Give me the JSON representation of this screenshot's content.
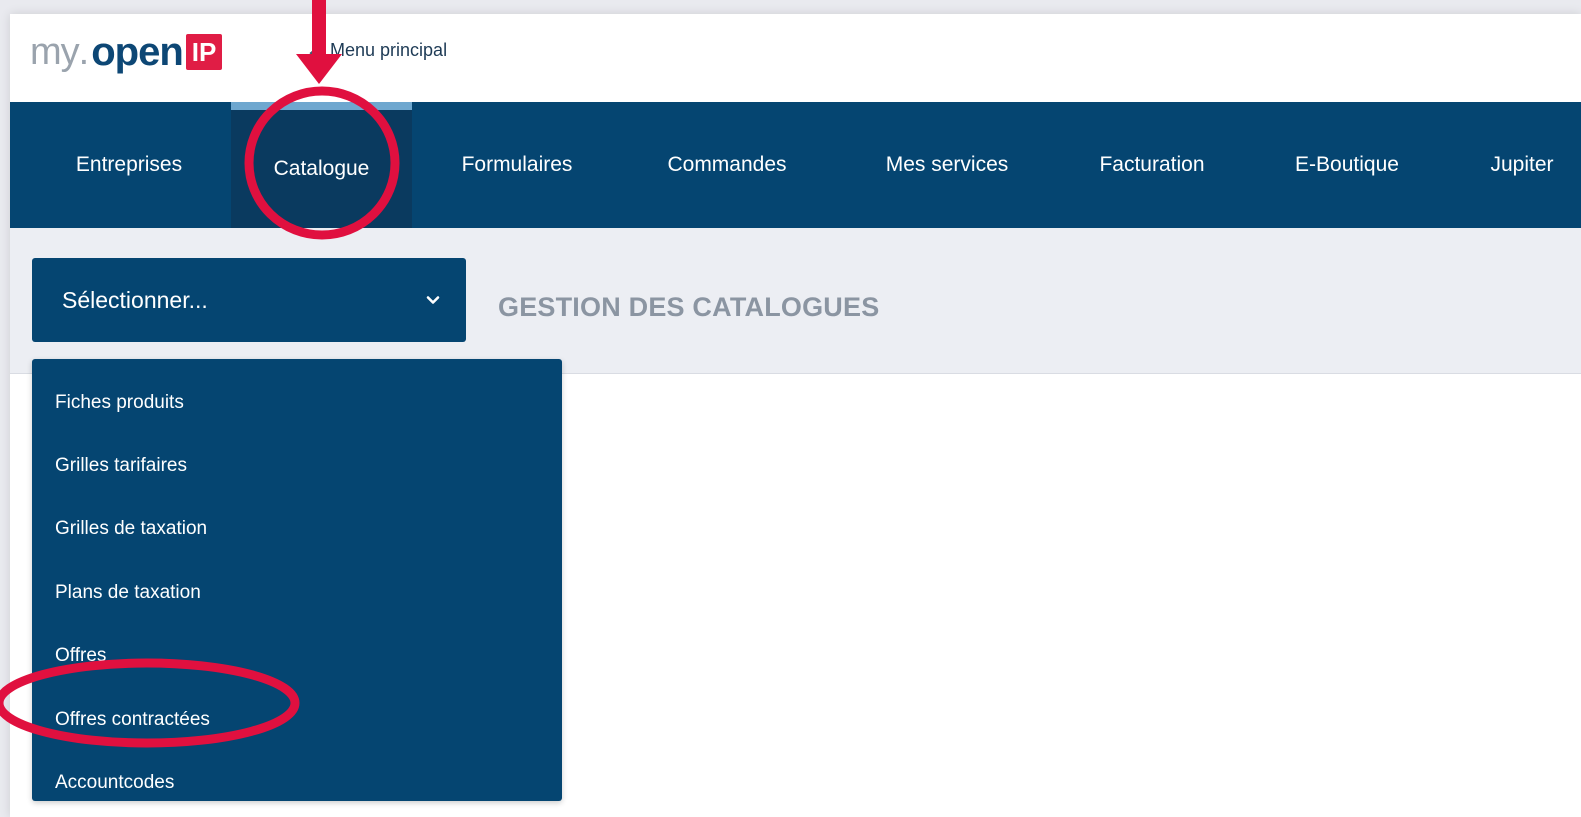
{
  "logo": {
    "my": "my",
    "dot": ".",
    "open": "open",
    "ip": "IP"
  },
  "topbar": {
    "menu_principal": "Menu principal"
  },
  "nav": [
    {
      "label": "Entreprises",
      "active": false
    },
    {
      "label": "Catalogue",
      "active": true
    },
    {
      "label": "Formulaires",
      "active": false
    },
    {
      "label": "Commandes",
      "active": false
    },
    {
      "label": "Mes services",
      "active": false
    },
    {
      "label": "Facturation",
      "active": false
    },
    {
      "label": "E-Boutique",
      "active": false
    },
    {
      "label": "Jupiter",
      "active": false
    }
  ],
  "select": {
    "value": "Sélectionner..."
  },
  "page_title": "GESTION DES CATALOGUES",
  "dropdown": {
    "items": [
      "Fiches produits",
      "Grilles tarifaires",
      "Grilles de taxation",
      "Plans de taxation",
      "Offres",
      "Offres contractées",
      "Accountcodes"
    ]
  },
  "colors": {
    "brand_navy": "#054571",
    "active_tab": "#0a3a5f",
    "active_tab_top": "#6ea7cf",
    "logo_red": "#e01d45",
    "annotation_red": "#e0103f",
    "title_gray": "#8b95a2"
  }
}
